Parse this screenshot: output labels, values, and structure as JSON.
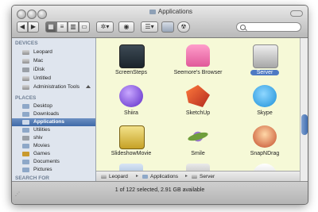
{
  "window": {
    "title": "Applications",
    "status": "1 of 122 selected, 2.91 GB available"
  },
  "toolbar": {
    "back_icon": "chevron-left-icon",
    "forward_icon": "chevron-right-icon",
    "views": [
      "icon-view",
      "list-view",
      "column-view",
      "cover-flow-view"
    ],
    "action_icon": "gear-icon",
    "quicklook_icon": "eye-icon",
    "arrange_icon": "arrange-icon",
    "search": {
      "placeholder": "",
      "value": ""
    }
  },
  "sidebar": {
    "devices_header": "DEVICES",
    "devices": [
      {
        "label": "Leopard",
        "icon": "drive-icon"
      },
      {
        "label": "Mac",
        "icon": "drive-icon"
      },
      {
        "label": "iDisk",
        "icon": "idisk-icon"
      },
      {
        "label": "Untitled",
        "icon": "drive-icon"
      },
      {
        "label": "Administration Tools",
        "icon": "drive-icon"
      }
    ],
    "places_header": "PLACES",
    "places": [
      {
        "label": "Desktop",
        "icon": "folder-icon"
      },
      {
        "label": "Downloads",
        "icon": "folder-icon"
      },
      {
        "label": "Applications",
        "icon": "folder-icon",
        "selected": true
      },
      {
        "label": "Utilities",
        "icon": "folder-icon"
      },
      {
        "label": "shiv",
        "icon": "home-icon"
      },
      {
        "label": "Movies",
        "icon": "folder-icon"
      },
      {
        "label": "Games",
        "icon": "folder-icon"
      },
      {
        "label": "Documents",
        "icon": "folder-icon"
      },
      {
        "label": "Pictures",
        "icon": "folder-icon"
      }
    ],
    "search_header": "SEARCH FOR"
  },
  "items": [
    {
      "label": "ScreenSteps"
    },
    {
      "label": "Seemore's Browser"
    },
    {
      "label": "Server",
      "selected": true
    },
    {
      "label": "Shiira"
    },
    {
      "label": "SketchUp"
    },
    {
      "label": "Skype"
    },
    {
      "label": "SlideshowMovie"
    },
    {
      "label": "Smile"
    },
    {
      "label": "SnapNDrag"
    }
  ],
  "pathbar": [
    "Leopard",
    "Applications",
    "Server"
  ]
}
